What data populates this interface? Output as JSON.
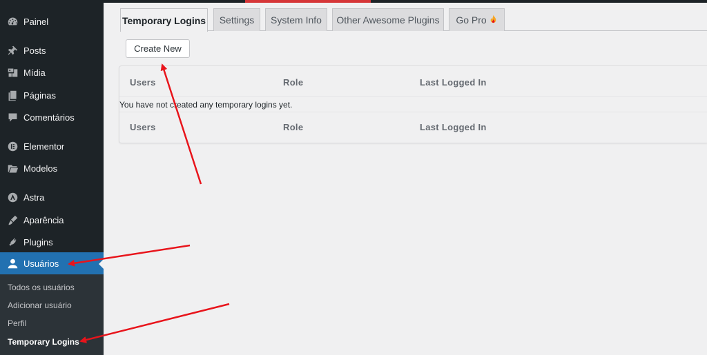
{
  "sidebar": {
    "items": [
      {
        "label": "Painel",
        "icon": "dashboard-icon"
      },
      {
        "label": "Posts",
        "icon": "pin-icon"
      },
      {
        "label": "Mídia",
        "icon": "media-icon"
      },
      {
        "label": "Páginas",
        "icon": "pages-icon"
      },
      {
        "label": "Comentários",
        "icon": "comments-icon"
      },
      {
        "label": "Elementor",
        "icon": "elementor-icon"
      },
      {
        "label": "Modelos",
        "icon": "folder-icon"
      },
      {
        "label": "Astra",
        "icon": "astra-icon"
      },
      {
        "label": "Aparência",
        "icon": "brush-icon"
      },
      {
        "label": "Plugins",
        "icon": "plugin-icon"
      },
      {
        "label": "Usuários",
        "icon": "user-icon"
      }
    ],
    "submenu": [
      {
        "label": "Todos os usuários"
      },
      {
        "label": "Adicionar usuário"
      },
      {
        "label": "Perfil"
      },
      {
        "label": "Temporary Logins"
      }
    ]
  },
  "tabs": [
    {
      "label": "Temporary Logins"
    },
    {
      "label": "Settings"
    },
    {
      "label": "System Info"
    },
    {
      "label": "Other Awesome Plugins"
    },
    {
      "label": "Go Pro",
      "icon": "fire-icon"
    }
  ],
  "main": {
    "create_button": "Create New",
    "columns": [
      "Users",
      "Role",
      "Last Logged In"
    ],
    "empty_message": "You have not created any temporary logins yet."
  },
  "colors": {
    "sidebar_bg": "#1d2327",
    "submenu_bg": "#2c3338",
    "active_item": "#2271b1",
    "content_bg": "#f0f0f1",
    "annotation_arrow": "#e8141b"
  }
}
